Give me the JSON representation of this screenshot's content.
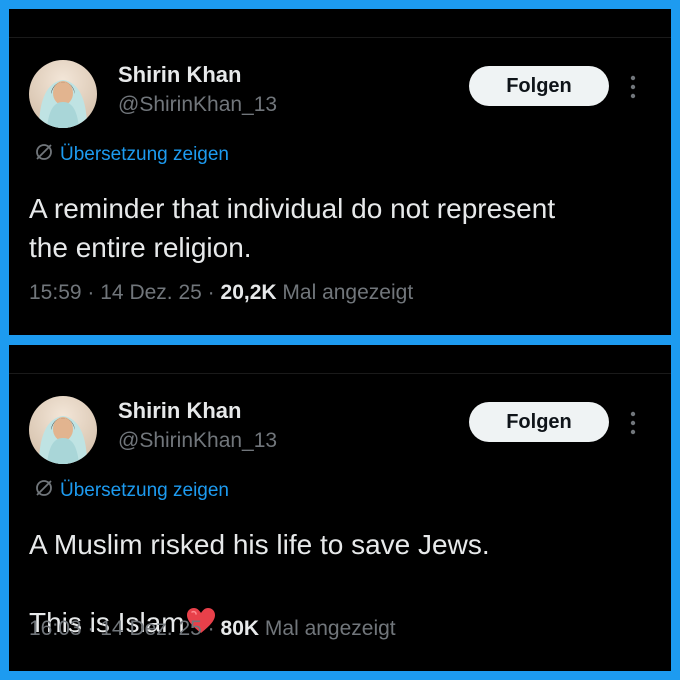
{
  "colors": {
    "frame": "#1d9bf0",
    "background": "#000000",
    "text_primary": "#e7e9ea",
    "text_secondary": "#71767b",
    "link": "#1d9bf0",
    "follow_button_bg": "#eff3f4",
    "follow_button_text": "#0f1419",
    "heart": "#e8404a"
  },
  "tweets": [
    {
      "author": {
        "display_name": "Shirin Khan",
        "handle": "@ShirinKhan_13",
        "avatar_icon": "profile-photo-avatar"
      },
      "follow_label": "Folgen",
      "more_icon": "vertical-ellipsis-icon",
      "translate_icon": "globe-icon",
      "translate_label": "Übersetzung zeigen",
      "text": "A reminder that individual do not represent\nthe entire religion.",
      "time": "15:59",
      "date": "14 Dez. 25",
      "views": "20,2K",
      "views_label": "Mal angezeigt",
      "separator": "·"
    },
    {
      "author": {
        "display_name": "Shirin Khan",
        "handle": "@ShirinKhan_13",
        "avatar_icon": "profile-photo-avatar"
      },
      "follow_label": "Folgen",
      "more_icon": "vertical-ellipsis-icon",
      "translate_icon": "globe-icon",
      "translate_label": "Übersetzung zeigen",
      "text": "A Muslim risked his life to save Jews.\n\nThis is Islam",
      "emoji_icon": "red-heart-icon",
      "time": "16:03",
      "date": "14 Dez. 25",
      "views": "80K",
      "views_label": "Mal angezeigt",
      "separator": "·"
    }
  ]
}
